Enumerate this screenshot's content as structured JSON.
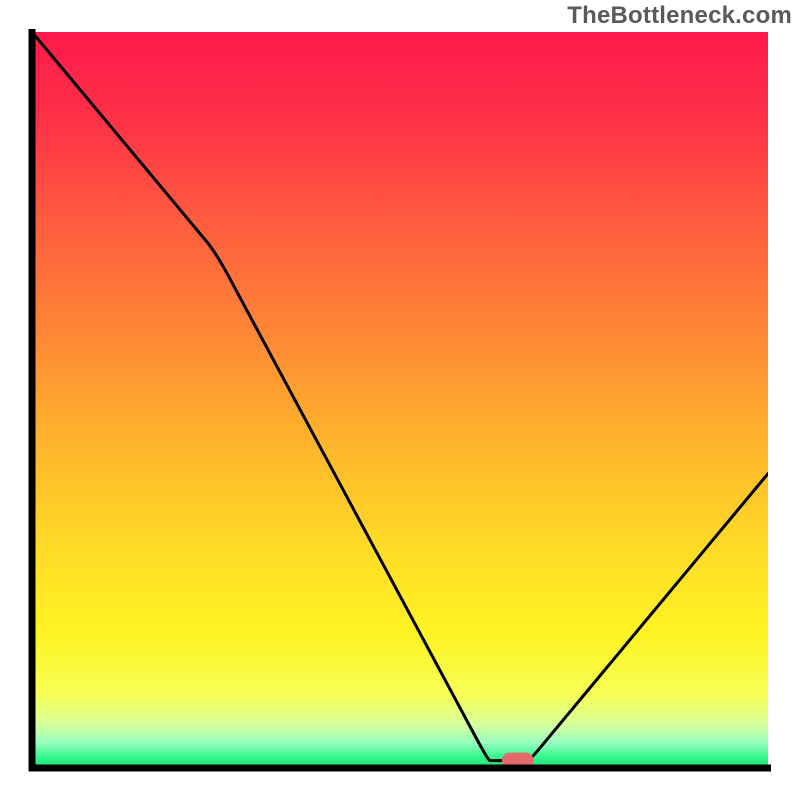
{
  "watermark": "TheBottleneck.com",
  "chart_data": {
    "type": "line",
    "title": "",
    "xlabel": "",
    "ylabel": "",
    "xlim": [
      0,
      100
    ],
    "ylim": [
      0,
      100
    ],
    "grid": false,
    "x": [
      0,
      25,
      62,
      66,
      68,
      100
    ],
    "values": [
      100,
      70,
      1,
      1,
      1.5,
      40
    ],
    "marker": {
      "x_center": 66,
      "y_center": 1
    },
    "gradient_stops": [
      {
        "offset": 0.0,
        "color": "#ff1a4b"
      },
      {
        "offset": 0.12,
        "color": "#ff3147"
      },
      {
        "offset": 0.25,
        "color": "#ff5a3f"
      },
      {
        "offset": 0.4,
        "color": "#ff8436"
      },
      {
        "offset": 0.55,
        "color": "#ffb22d"
      },
      {
        "offset": 0.7,
        "color": "#ffdb26"
      },
      {
        "offset": 0.82,
        "color": "#fff423"
      },
      {
        "offset": 0.9,
        "color": "#f5ff55"
      },
      {
        "offset": 0.94,
        "color": "#d8ff9a"
      },
      {
        "offset": 0.965,
        "color": "#9bffc1"
      },
      {
        "offset": 0.985,
        "color": "#36f58a"
      },
      {
        "offset": 1.0,
        "color": "#18e876"
      }
    ],
    "marker_color": "#e26a6a",
    "curve_color": "#000000",
    "axis_color": "#000000"
  }
}
